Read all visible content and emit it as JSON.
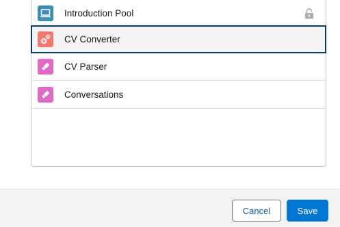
{
  "list": {
    "items": [
      {
        "label": "Introduction Pool",
        "icon": "laptop-icon",
        "color": "#3a8fb7",
        "locked": true
      },
      {
        "label": "CV Converter",
        "icon": "gears-icon",
        "color": "#f4776e",
        "selected": true
      },
      {
        "label": "CV Parser",
        "icon": "eraser-icon",
        "color": "#e169c3"
      },
      {
        "label": "Conversations",
        "icon": "eraser-icon",
        "color": "#e169c3"
      }
    ]
  },
  "footer": {
    "cancel_label": "Cancel",
    "save_label": "Save"
  },
  "colors": {
    "accent": "#0176d3",
    "selected_border": "#0b3a6e"
  }
}
